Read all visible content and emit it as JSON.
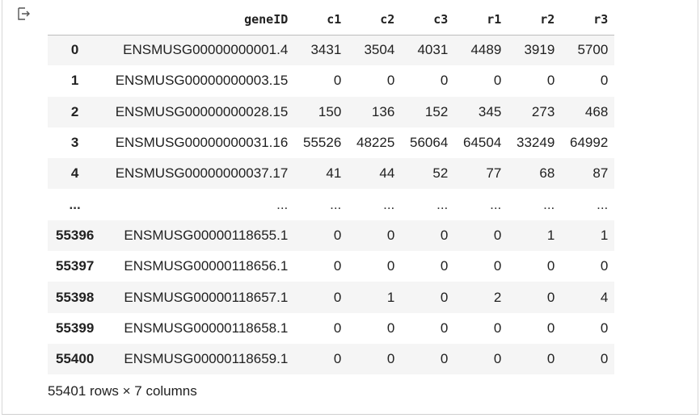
{
  "table": {
    "columns": [
      "",
      "geneID",
      "c1",
      "c2",
      "c3",
      "r1",
      "r2",
      "r3"
    ],
    "rows": [
      [
        "0",
        "ENSMUSG00000000001.4",
        "3431",
        "3504",
        "4031",
        "4489",
        "3919",
        "5700"
      ],
      [
        "1",
        "ENSMUSG00000000003.15",
        "0",
        "0",
        "0",
        "0",
        "0",
        "0"
      ],
      [
        "2",
        "ENSMUSG00000000028.15",
        "150",
        "136",
        "152",
        "345",
        "273",
        "468"
      ],
      [
        "3",
        "ENSMUSG00000000031.16",
        "55526",
        "48225",
        "56064",
        "64504",
        "33249",
        "64992"
      ],
      [
        "4",
        "ENSMUSG00000000037.17",
        "41",
        "44",
        "52",
        "77",
        "68",
        "87"
      ],
      [
        "...",
        "...",
        "...",
        "...",
        "...",
        "...",
        "...",
        "..."
      ],
      [
        "55396",
        "ENSMUSG00000118655.1",
        "0",
        "0",
        "0",
        "0",
        "1",
        "1"
      ],
      [
        "55397",
        "ENSMUSG00000118656.1",
        "0",
        "0",
        "0",
        "0",
        "0",
        "0"
      ],
      [
        "55398",
        "ENSMUSG00000118657.1",
        "0",
        "1",
        "0",
        "2",
        "0",
        "4"
      ],
      [
        "55399",
        "ENSMUSG00000118658.1",
        "0",
        "0",
        "0",
        "0",
        "0",
        "0"
      ],
      [
        "55400",
        "ENSMUSG00000118659.1",
        "0",
        "0",
        "0",
        "0",
        "0",
        "0"
      ]
    ]
  },
  "shape_text": "55401 rows × 7 columns",
  "icons": {
    "output": "output-arrow-icon"
  },
  "colors": {
    "header_rule": "#bdbdbd",
    "stripe": "#f5f5f5",
    "text": "#212121"
  }
}
